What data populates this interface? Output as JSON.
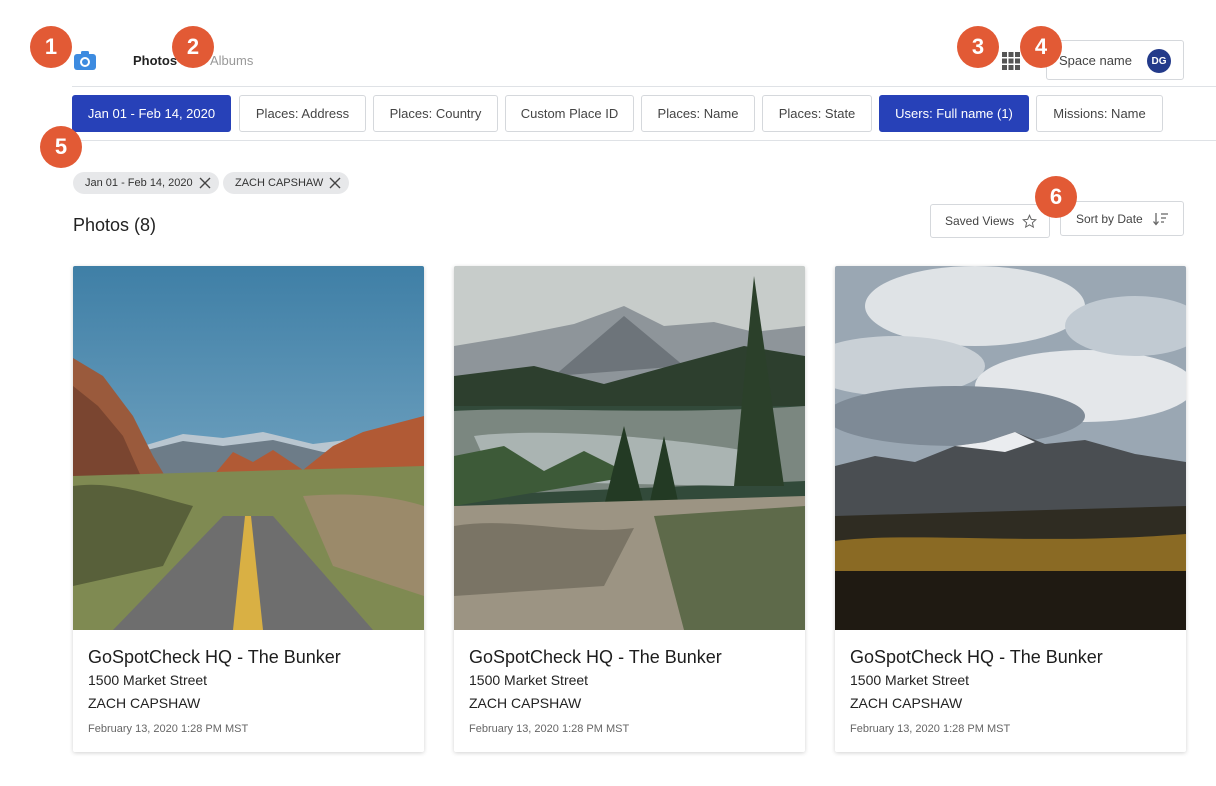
{
  "nav": {
    "photos_label": "Photos",
    "albums_label": "Albums"
  },
  "space": {
    "name": "Space name",
    "avatar_initials": "DG"
  },
  "filters": [
    {
      "label": "Jan 01 - Feb 14, 2020",
      "active": true
    },
    {
      "label": "Places: Address",
      "active": false
    },
    {
      "label": "Places: Country",
      "active": false
    },
    {
      "label": "Custom Place ID",
      "active": false
    },
    {
      "label": "Places: Name",
      "active": false
    },
    {
      "label": "Places: State",
      "active": false
    },
    {
      "label": "Users: Full name (1)",
      "active": true
    },
    {
      "label": "Missions: Name",
      "active": false
    }
  ],
  "chips": [
    {
      "label": "Jan 01 - Feb 14, 2020"
    },
    {
      "label": "ZACH CAPSHAW"
    }
  ],
  "results": {
    "title": "Photos (8)"
  },
  "saved_views_label": "Saved Views",
  "sort_label": "Sort by Date",
  "cards": [
    {
      "title": "GoSpotCheck HQ - The Bunker",
      "address": "1500 Market Street",
      "user": "ZACH CAPSHAW",
      "date": "February 13, 2020 1:28 PM MST"
    },
    {
      "title": "GoSpotCheck HQ - The Bunker",
      "address": "1500 Market Street",
      "user": "ZACH CAPSHAW",
      "date": "February 13, 2020 1:28 PM MST"
    },
    {
      "title": "GoSpotCheck HQ - The Bunker",
      "address": "1500 Market Street",
      "user": "ZACH CAPSHAW",
      "date": "February 13, 2020 1:28 PM MST"
    }
  ],
  "markers": [
    "1",
    "2",
    "3",
    "4",
    "5",
    "6"
  ],
  "colors": {
    "accent": "#2741b8",
    "marker": "#e25a35",
    "camera": "#3d8be0"
  },
  "icons": [
    "camera-icon",
    "apps-grid-icon",
    "close-icon",
    "star-icon",
    "sort-icon"
  ]
}
